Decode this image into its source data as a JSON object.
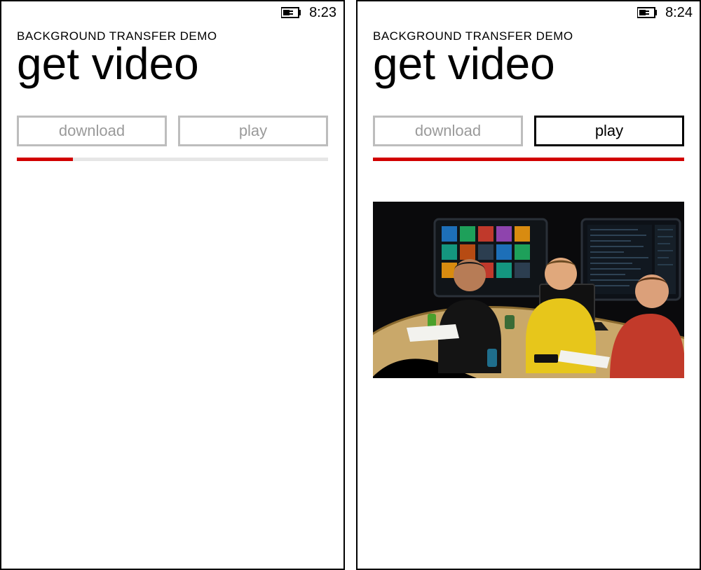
{
  "screens": [
    {
      "status": {
        "time": "8:23",
        "battery": "charging"
      },
      "app_title": "BACKGROUND TRANSFER DEMO",
      "page_title": "get video",
      "buttons": {
        "download": {
          "label": "download",
          "enabled": false
        },
        "play": {
          "label": "play",
          "enabled": false
        }
      },
      "progress_percent": 18,
      "video_visible": false
    },
    {
      "status": {
        "time": "8:24",
        "battery": "charging"
      },
      "app_title": "BACKGROUND TRANSFER DEMO",
      "page_title": "get video",
      "buttons": {
        "download": {
          "label": "download",
          "enabled": false
        },
        "play": {
          "label": "play",
          "enabled": true
        }
      },
      "progress_percent": 100,
      "video_visible": true
    }
  ],
  "colors": {
    "accent": "#d10000",
    "disabled_border": "#bdbdbd",
    "disabled_text": "#9a9a9a",
    "progress_track": "#e6e6e6"
  }
}
